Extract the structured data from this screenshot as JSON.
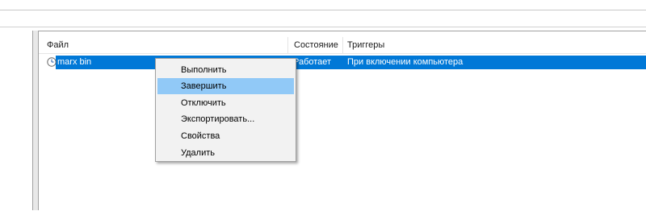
{
  "columns": {
    "file": "Файл",
    "state": "Состояние",
    "triggers": "Триггеры"
  },
  "tasks": [
    {
      "name": "marx bin",
      "state": "Работает",
      "trigger": "При включении компьютера",
      "icon": "clock-icon",
      "selected": true
    }
  ],
  "context_menu": {
    "items": [
      {
        "label": "Выполнить"
      },
      {
        "label": "Завершить",
        "hovered": true
      },
      {
        "label": "Отключить"
      },
      {
        "label": "Экспортировать..."
      },
      {
        "label": "Свойства"
      },
      {
        "label": "Удалить"
      }
    ]
  },
  "colors": {
    "selection": "#0078d7",
    "menu_hover": "#91c9f7",
    "menu_background": "#f2f2f2"
  }
}
